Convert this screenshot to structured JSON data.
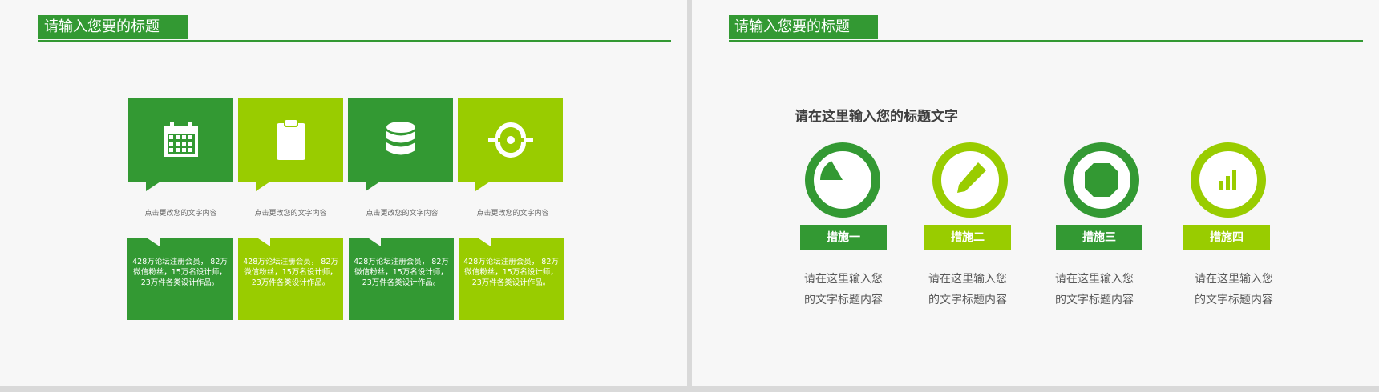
{
  "slides": [
    {
      "title": "请输入您要的标题",
      "cards": [
        {
          "icon": "calendar-icon",
          "caption": "点击更改您的文字内容",
          "text": "428万论坛注册会员， 82万微信粉丝，15万名设计师，23万件各类设计作品。",
          "tone": "dark"
        },
        {
          "icon": "clipboard-icon",
          "caption": "点击更改您的文字内容",
          "text": "428万论坛注册会员， 82万微信粉丝，15万名设计师，23万件各类设计作品。",
          "tone": "light"
        },
        {
          "icon": "database-icon",
          "caption": "点击更改您的文字内容",
          "text": "428万论坛注册会员， 82万微信粉丝，15万名设计师，23万件各类设计作品。",
          "tone": "dark"
        },
        {
          "icon": "sync-icon",
          "caption": "点击更改您的文字内容",
          "text": "428万论坛注册会员， 82万微信粉丝，15万名设计师，23万件各类设计作品。",
          "tone": "light"
        }
      ]
    },
    {
      "title": "请输入您要的标题",
      "subtitle": "请在这里输入您的标题文字",
      "measures": [
        {
          "icon": "pie-chart-icon",
          "label": "措施一",
          "desc_line1": "请在这里输入您",
          "desc_line2": "的文字标题内容",
          "tone": "dark"
        },
        {
          "icon": "pencil-icon",
          "label": "措施二",
          "desc_line1": "请在这里输入您",
          "desc_line2": "的文字标题内容",
          "tone": "light"
        },
        {
          "icon": "octagon-icon",
          "label": "措施三",
          "desc_line1": "请在这里输入您",
          "desc_line2": "的文字标题内容",
          "tone": "dark"
        },
        {
          "icon": "bar-chart-icon",
          "label": "措施四",
          "desc_line1": "请在这里输入您",
          "desc_line2": "的文字标题内容",
          "tone": "light"
        }
      ]
    }
  ],
  "colors": {
    "dark_green": "#339933",
    "light_green": "#99cc00",
    "background": "#f7f7f7"
  }
}
